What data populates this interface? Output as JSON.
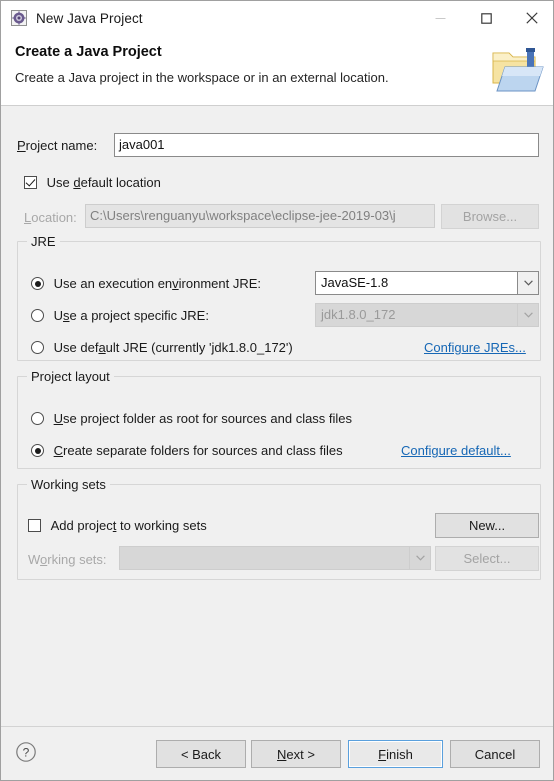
{
  "window": {
    "title": "New Java Project",
    "icon": "java-project-icon",
    "controls": {
      "minimize": "minimize-button",
      "maximize": "maximize-button",
      "close": "close-button"
    }
  },
  "header": {
    "title": "Create a Java Project",
    "subtitle": "Create a Java project in the workspace or in an external location.",
    "image": "java-project-folder-icon"
  },
  "project": {
    "name_label": "Project name:",
    "name_value": "java001",
    "name_placeholder": "",
    "use_default_location_label": "Use default location",
    "use_default_location_checked": true,
    "location_label": "Location:",
    "location_value": "C:\\Users\\renguanyu\\workspace\\eclipse-jee-2019-03\\j",
    "location_enabled": false,
    "browse_label": "Browse...",
    "browse_enabled": false
  },
  "jre": {
    "group_title": "JRE",
    "options": [
      {
        "label": "Use an execution environment JRE:",
        "selected": true,
        "value": "JavaSE-1.8",
        "value_enabled": true
      },
      {
        "label": "Use a project specific JRE:",
        "selected": false,
        "value": "jdk1.8.0_172",
        "value_enabled": false
      },
      {
        "label": "Use default JRE (currently 'jdk1.8.0_172')",
        "selected": false
      }
    ],
    "configure_link": "Configure JREs..."
  },
  "layout": {
    "group_title": "Project layout",
    "options": [
      {
        "label": "Use project folder as root for sources and class files",
        "selected": false
      },
      {
        "label": "Create separate folders for sources and class files",
        "selected": true
      }
    ],
    "configure_link": "Configure default..."
  },
  "working_sets": {
    "group_title": "Working sets",
    "add_label": "Add project to working sets",
    "add_checked": false,
    "sets_label": "Working sets:",
    "sets_value": "",
    "sets_enabled": false,
    "new_label": "New...",
    "new_enabled": true,
    "select_label": "Select...",
    "select_enabled": false
  },
  "footer": {
    "help_icon": "help-icon",
    "back_label": "< Back",
    "next_label": "Next >",
    "finish_label": "Finish",
    "cancel_label": "Cancel",
    "default_button": "Finish"
  },
  "colors": {
    "dialog_bg": "#f0f0f0",
    "header_bg": "#ffffff",
    "link": "#1667b5",
    "focus_border": "#5aa0dd",
    "disabled_text": "#a3a3a3"
  }
}
